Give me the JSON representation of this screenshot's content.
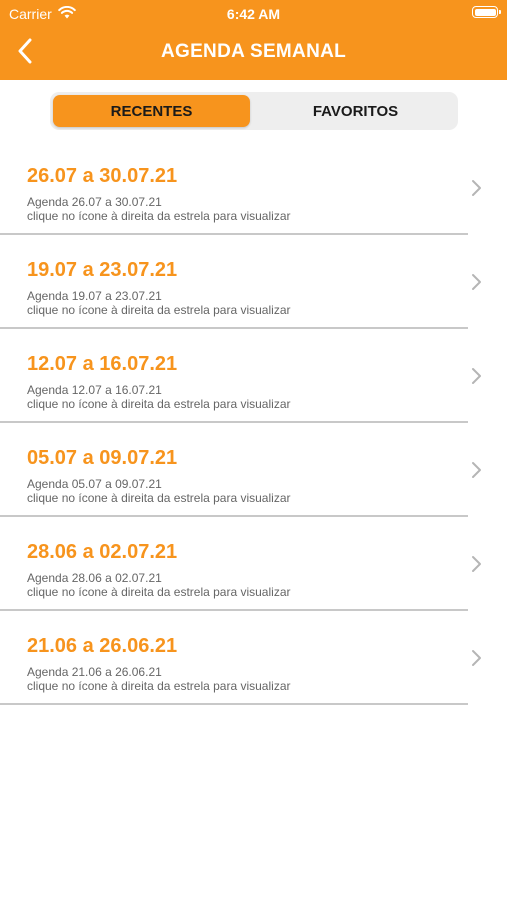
{
  "status_bar": {
    "carrier": "Carrier",
    "time": "6:42 AM"
  },
  "header": {
    "title": "AGENDA SEMANAL"
  },
  "tabs": [
    {
      "label": "RECENTES"
    },
    {
      "label": "FAVORITOS"
    }
  ],
  "items": [
    {
      "title": "26.07 a 30.07.21",
      "subtitle": "Agenda 26.07 a 30.07.21",
      "hint": "clique no ícone à direita da estrela para visualizar"
    },
    {
      "title": "19.07 a 23.07.21",
      "subtitle": "Agenda 19.07 a 23.07.21",
      "hint": "clique no ícone à direita da estrela para visualizar"
    },
    {
      "title": "12.07 a 16.07.21",
      "subtitle": "Agenda 12.07 a 16.07.21",
      "hint": "clique no ícone à direita da estrela para visualizar"
    },
    {
      "title": "05.07 a 09.07.21",
      "subtitle": "Agenda 05.07 a 09.07.21",
      "hint": "clique no ícone à direita da estrela para visualizar"
    },
    {
      "title": "28.06 a 02.07.21",
      "subtitle": "Agenda 28.06 a 02.07.21",
      "hint": "clique no ícone à direita da estrela para visualizar"
    },
    {
      "title": "21.06 a 26.06.21",
      "subtitle": "Agenda 21.06 a 26.06.21",
      "hint": "clique no ícone à direita da estrela para visualizar"
    }
  ],
  "colors": {
    "accent": "#f7941d",
    "subtitle_text": "#666666",
    "separator": "#c8c8c8",
    "segment_bg": "#eeeeee"
  },
  "icons": {
    "back": "chevron-left-icon",
    "row_action": "chevron-right-icon",
    "wifi": "wifi-icon",
    "battery": "battery-icon"
  }
}
